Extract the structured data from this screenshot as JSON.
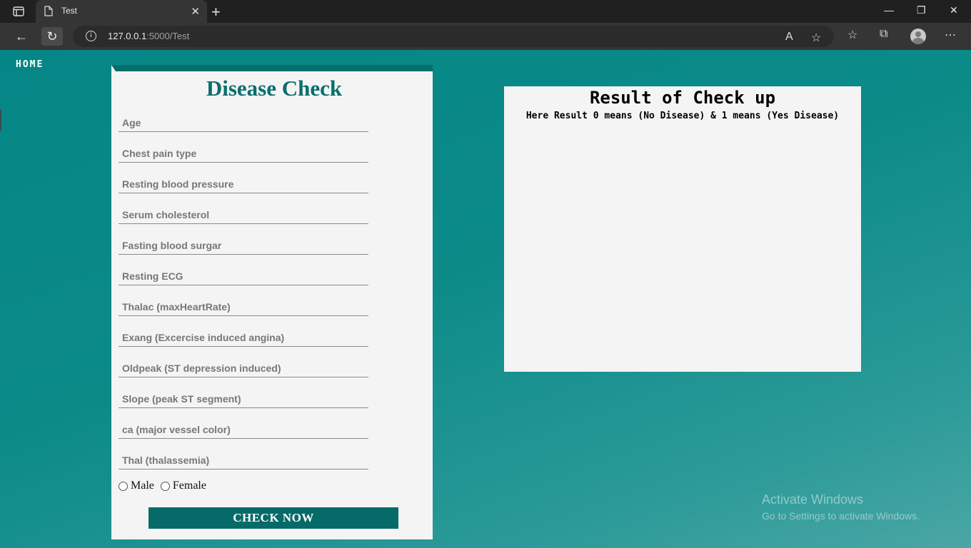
{
  "browser": {
    "tab_title": "Test",
    "new_tab": "+",
    "url_host": "127.0.0.1",
    "url_path": ":5000/Test"
  },
  "page": {
    "home_link": "HOME",
    "form": {
      "title": "Disease Check",
      "fields": [
        {
          "placeholder": "Age"
        },
        {
          "placeholder": "Chest pain type"
        },
        {
          "placeholder": "Resting blood pressure"
        },
        {
          "placeholder": "Serum cholesterol"
        },
        {
          "placeholder": "Fasting blood surgar"
        },
        {
          "placeholder": "Resting ECG"
        },
        {
          "placeholder": "Thalac (maxHeartRate)"
        },
        {
          "placeholder": "Exang (Excercise induced angina)"
        },
        {
          "placeholder": "Oldpeak (ST depression induced)"
        },
        {
          "placeholder": "Slope (peak ST segment)"
        },
        {
          "placeholder": "ca (major vessel color)"
        },
        {
          "placeholder": "Thal (thalassemia)"
        }
      ],
      "gender_male": "Male",
      "gender_female": "Female",
      "submit_label": "CHECK NOW"
    },
    "result": {
      "title": "Result of Check up",
      "note": "Here Result 0 means (No Disease) & 1 means (Yes Disease)"
    }
  },
  "os_watermark": {
    "line1": "Activate Windows",
    "line2": "Go to Settings to activate Windows."
  },
  "colors": {
    "accent": "#066e6c",
    "background": "#0b8a88",
    "card": "#f4f4f4"
  }
}
